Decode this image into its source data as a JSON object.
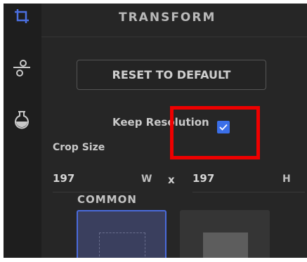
{
  "sidebar": {
    "items": [
      {
        "icon": "crop-icon",
        "active": true
      },
      {
        "icon": "adjust-icon",
        "active": false
      },
      {
        "icon": "flask-icon",
        "active": false
      }
    ]
  },
  "panel": {
    "title": "TRANSFORM",
    "reset_label": "RESET TO DEFAULT",
    "keep_resolution_label": "Keep Resolution",
    "keep_resolution_checked": true,
    "crop_size_label": "Crop Size",
    "width_value": "197",
    "width_unit": "W",
    "separator": "x",
    "height_value": "197",
    "height_unit": "H",
    "common_label": "COMMON"
  },
  "colors": {
    "accent": "#3b6fe8",
    "highlight": "#ee0000",
    "background": "#242424"
  }
}
